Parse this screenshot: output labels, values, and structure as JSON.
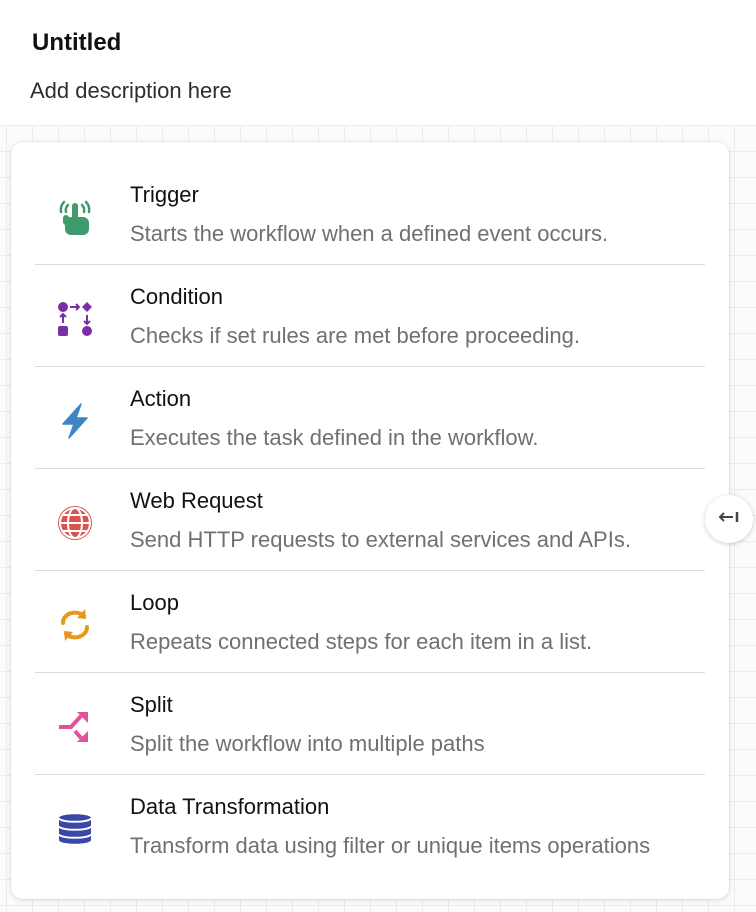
{
  "header": {
    "title": "Untitled",
    "description": "Add description here"
  },
  "menu": {
    "items": [
      {
        "label": "Trigger",
        "description": "Starts the workflow when a defined event occurs.",
        "icon": "hand-tap-icon",
        "color": "#3f9b6b"
      },
      {
        "label": "Condition",
        "description": "Checks if set rules are met before proceeding.",
        "icon": "condition-flow-icon",
        "color": "#7b2fa6"
      },
      {
        "label": "Action",
        "description": "Executes the task defined in the workflow.",
        "icon": "lightning-bolt-icon",
        "color": "#3d86c6"
      },
      {
        "label": "Web Request",
        "description": "Send HTTP requests to external services and APIs.",
        "icon": "globe-icon",
        "color": "#d9534f"
      },
      {
        "label": "Loop",
        "description": "Repeats connected steps for each item in a list.",
        "icon": "loop-arrows-icon",
        "color": "#e9961c"
      },
      {
        "label": "Split",
        "description": "Split the workflow into multiple paths",
        "icon": "split-arrows-icon",
        "color": "#e2529c"
      },
      {
        "label": "Data Transformation",
        "description": "Transform data using filter or unique items operations",
        "icon": "database-icon",
        "color": "#3a47a8"
      }
    ]
  },
  "collapse_button": {
    "icon": "collapse-left-arrow-icon"
  }
}
